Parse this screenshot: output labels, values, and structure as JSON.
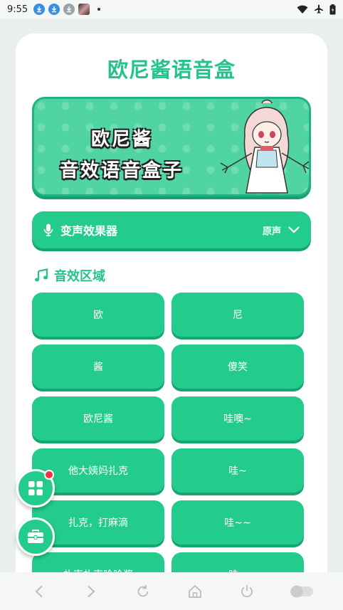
{
  "status_bar": {
    "time": "9:55"
  },
  "app": {
    "title": "欧尼酱语音盒"
  },
  "banner": {
    "line1": "欧尼酱",
    "line2": "音效语音盒子"
  },
  "voice_changer": {
    "label": "变声效果器",
    "value": "原声"
  },
  "section": {
    "title": "音效区域"
  },
  "sounds": [
    "欧",
    "尼",
    "酱",
    "傻笑",
    "欧尼酱",
    "哇噢~",
    "他大姨妈扎克",
    "哇~",
    "扎克，打麻滴",
    "哇~~",
    "扎克扎克哈哈酱",
    "哇~"
  ],
  "colors": {
    "accent": "#23cc8c",
    "title": "#23c48b",
    "badge": "#ee3344"
  }
}
